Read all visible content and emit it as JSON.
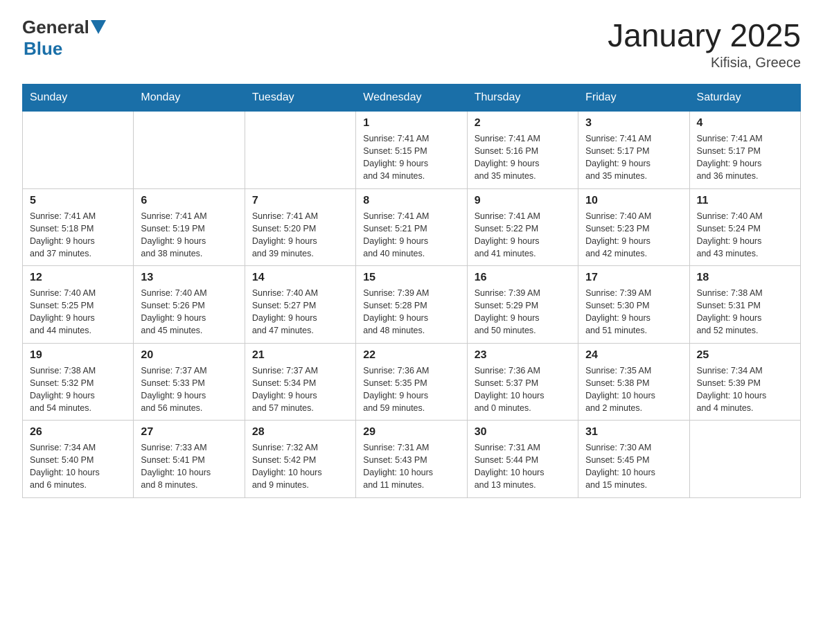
{
  "header": {
    "logo_general": "General",
    "logo_arrow": "▶",
    "logo_blue": "Blue",
    "title": "January 2025",
    "subtitle": "Kifisia, Greece"
  },
  "days_of_week": [
    "Sunday",
    "Monday",
    "Tuesday",
    "Wednesday",
    "Thursday",
    "Friday",
    "Saturday"
  ],
  "weeks": [
    [
      {
        "day": "",
        "info": ""
      },
      {
        "day": "",
        "info": ""
      },
      {
        "day": "",
        "info": ""
      },
      {
        "day": "1",
        "info": "Sunrise: 7:41 AM\nSunset: 5:15 PM\nDaylight: 9 hours\nand 34 minutes."
      },
      {
        "day": "2",
        "info": "Sunrise: 7:41 AM\nSunset: 5:16 PM\nDaylight: 9 hours\nand 35 minutes."
      },
      {
        "day": "3",
        "info": "Sunrise: 7:41 AM\nSunset: 5:17 PM\nDaylight: 9 hours\nand 35 minutes."
      },
      {
        "day": "4",
        "info": "Sunrise: 7:41 AM\nSunset: 5:17 PM\nDaylight: 9 hours\nand 36 minutes."
      }
    ],
    [
      {
        "day": "5",
        "info": "Sunrise: 7:41 AM\nSunset: 5:18 PM\nDaylight: 9 hours\nand 37 minutes."
      },
      {
        "day": "6",
        "info": "Sunrise: 7:41 AM\nSunset: 5:19 PM\nDaylight: 9 hours\nand 38 minutes."
      },
      {
        "day": "7",
        "info": "Sunrise: 7:41 AM\nSunset: 5:20 PM\nDaylight: 9 hours\nand 39 minutes."
      },
      {
        "day": "8",
        "info": "Sunrise: 7:41 AM\nSunset: 5:21 PM\nDaylight: 9 hours\nand 40 minutes."
      },
      {
        "day": "9",
        "info": "Sunrise: 7:41 AM\nSunset: 5:22 PM\nDaylight: 9 hours\nand 41 minutes."
      },
      {
        "day": "10",
        "info": "Sunrise: 7:40 AM\nSunset: 5:23 PM\nDaylight: 9 hours\nand 42 minutes."
      },
      {
        "day": "11",
        "info": "Sunrise: 7:40 AM\nSunset: 5:24 PM\nDaylight: 9 hours\nand 43 minutes."
      }
    ],
    [
      {
        "day": "12",
        "info": "Sunrise: 7:40 AM\nSunset: 5:25 PM\nDaylight: 9 hours\nand 44 minutes."
      },
      {
        "day": "13",
        "info": "Sunrise: 7:40 AM\nSunset: 5:26 PM\nDaylight: 9 hours\nand 45 minutes."
      },
      {
        "day": "14",
        "info": "Sunrise: 7:40 AM\nSunset: 5:27 PM\nDaylight: 9 hours\nand 47 minutes."
      },
      {
        "day": "15",
        "info": "Sunrise: 7:39 AM\nSunset: 5:28 PM\nDaylight: 9 hours\nand 48 minutes."
      },
      {
        "day": "16",
        "info": "Sunrise: 7:39 AM\nSunset: 5:29 PM\nDaylight: 9 hours\nand 50 minutes."
      },
      {
        "day": "17",
        "info": "Sunrise: 7:39 AM\nSunset: 5:30 PM\nDaylight: 9 hours\nand 51 minutes."
      },
      {
        "day": "18",
        "info": "Sunrise: 7:38 AM\nSunset: 5:31 PM\nDaylight: 9 hours\nand 52 minutes."
      }
    ],
    [
      {
        "day": "19",
        "info": "Sunrise: 7:38 AM\nSunset: 5:32 PM\nDaylight: 9 hours\nand 54 minutes."
      },
      {
        "day": "20",
        "info": "Sunrise: 7:37 AM\nSunset: 5:33 PM\nDaylight: 9 hours\nand 56 minutes."
      },
      {
        "day": "21",
        "info": "Sunrise: 7:37 AM\nSunset: 5:34 PM\nDaylight: 9 hours\nand 57 minutes."
      },
      {
        "day": "22",
        "info": "Sunrise: 7:36 AM\nSunset: 5:35 PM\nDaylight: 9 hours\nand 59 minutes."
      },
      {
        "day": "23",
        "info": "Sunrise: 7:36 AM\nSunset: 5:37 PM\nDaylight: 10 hours\nand 0 minutes."
      },
      {
        "day": "24",
        "info": "Sunrise: 7:35 AM\nSunset: 5:38 PM\nDaylight: 10 hours\nand 2 minutes."
      },
      {
        "day": "25",
        "info": "Sunrise: 7:34 AM\nSunset: 5:39 PM\nDaylight: 10 hours\nand 4 minutes."
      }
    ],
    [
      {
        "day": "26",
        "info": "Sunrise: 7:34 AM\nSunset: 5:40 PM\nDaylight: 10 hours\nand 6 minutes."
      },
      {
        "day": "27",
        "info": "Sunrise: 7:33 AM\nSunset: 5:41 PM\nDaylight: 10 hours\nand 8 minutes."
      },
      {
        "day": "28",
        "info": "Sunrise: 7:32 AM\nSunset: 5:42 PM\nDaylight: 10 hours\nand 9 minutes."
      },
      {
        "day": "29",
        "info": "Sunrise: 7:31 AM\nSunset: 5:43 PM\nDaylight: 10 hours\nand 11 minutes."
      },
      {
        "day": "30",
        "info": "Sunrise: 7:31 AM\nSunset: 5:44 PM\nDaylight: 10 hours\nand 13 minutes."
      },
      {
        "day": "31",
        "info": "Sunrise: 7:30 AM\nSunset: 5:45 PM\nDaylight: 10 hours\nand 15 minutes."
      },
      {
        "day": "",
        "info": ""
      }
    ]
  ]
}
